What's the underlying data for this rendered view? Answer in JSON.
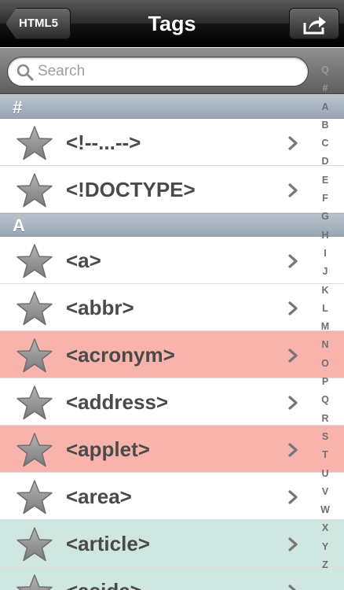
{
  "nav": {
    "title": "Tags",
    "back_label": "HTML5",
    "share_icon": "share-icon"
  },
  "search": {
    "placeholder": "Search",
    "value": ""
  },
  "sections": [
    {
      "title": "#",
      "items": [
        {
          "label": "<!--...-->",
          "highlight": "none"
        },
        {
          "label": "<!DOCTYPE>",
          "highlight": "none"
        }
      ]
    },
    {
      "title": "A",
      "items": [
        {
          "label": "<a>",
          "highlight": "none"
        },
        {
          "label": "<abbr>",
          "highlight": "none"
        },
        {
          "label": "<acronym>",
          "highlight": "red"
        },
        {
          "label": "<address>",
          "highlight": "none"
        },
        {
          "label": "<applet>",
          "highlight": "red"
        },
        {
          "label": "<area>",
          "highlight": "none"
        },
        {
          "label": "<article>",
          "highlight": "teal"
        },
        {
          "label": "<aside>",
          "highlight": "teal"
        }
      ]
    }
  ],
  "index": [
    "Q",
    "#",
    "A",
    "B",
    "C",
    "D",
    "E",
    "F",
    "G",
    "H",
    "I",
    "J",
    "K",
    "L",
    "M",
    "N",
    "O",
    "P",
    "Q",
    "R",
    "S",
    "T",
    "U",
    "V",
    "W",
    "X",
    "Y",
    "Z"
  ],
  "colors": {
    "highlight_red": "#f7b3ac",
    "highlight_teal": "#cfe6e1",
    "section_header": "#a9b5c1"
  }
}
